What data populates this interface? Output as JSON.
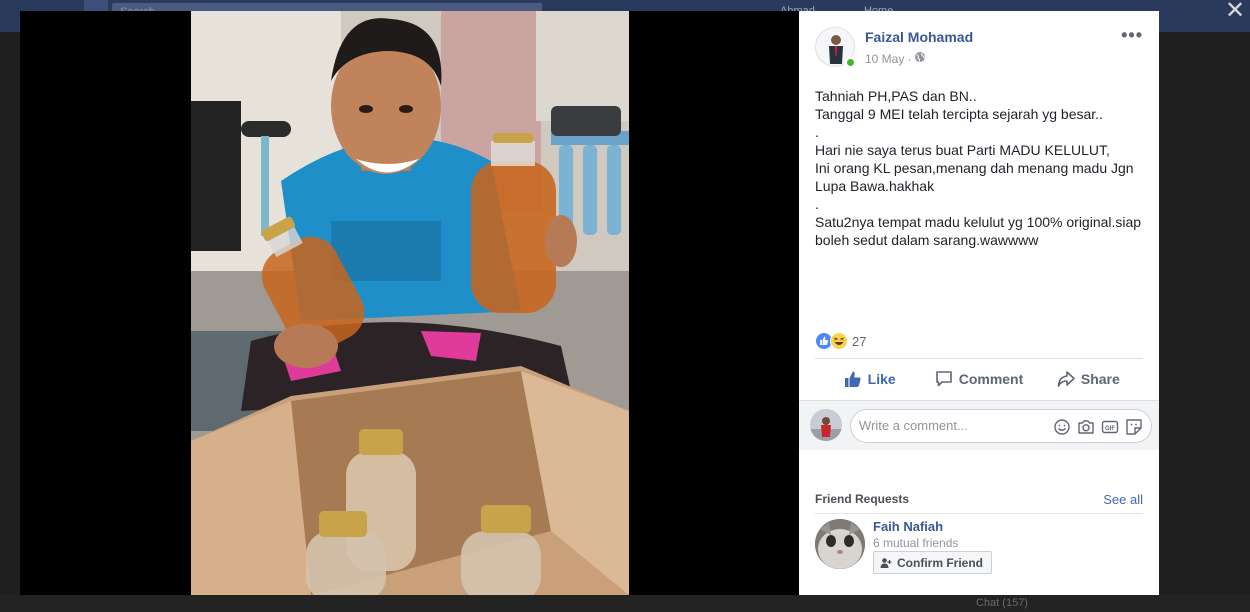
{
  "background": {
    "search_text": "Search",
    "nav_name": "Ahmad",
    "nav_home": "Home",
    "chat_label": "Chat (157)"
  },
  "close_icon": "close-icon",
  "photo": {
    "description_icon": "photo",
    "colors": {
      "shirt": "#1e8fc8",
      "honey": "#c8651c",
      "box": "#c9a07a"
    }
  },
  "post": {
    "author": "Faizal Mohamad",
    "date": "10 May",
    "separator": "·",
    "privacy_icon": "globe-icon",
    "more_label": "•••",
    "lines": [
      "Tahniah PH,PAS dan BN..",
      "Tanggal 9 MEI telah tercipta sejarah yg besar..",
      ".",
      "Hari nie saya terus buat Parti MADU KELULUT,",
      "Ini orang KL pesan,menang dah menang madu Jgn Lupa Bawa.hakhak",
      ".",
      "Satu2nya tempat madu kelulut yg 100% original.siap boleh sedut dalam sarang.wawwww"
    ],
    "reaction_count": "27",
    "actions": {
      "like": "Like",
      "comment": "Comment",
      "share": "Share"
    }
  },
  "comment": {
    "placeholder": "Write a comment...",
    "icons": [
      "emoji-icon",
      "camera-icon",
      "gif-icon",
      "sticker-icon"
    ]
  },
  "friend_requests": {
    "header": "Friend Requests",
    "see_all": "See all",
    "items": [
      {
        "name": "Faih Nafiah",
        "mutual": "6 mutual friends",
        "confirm_label": "Confirm Friend"
      }
    ]
  },
  "colors": {
    "brand": "#4267b2",
    "link": "#385898",
    "online": "#42b72a"
  }
}
